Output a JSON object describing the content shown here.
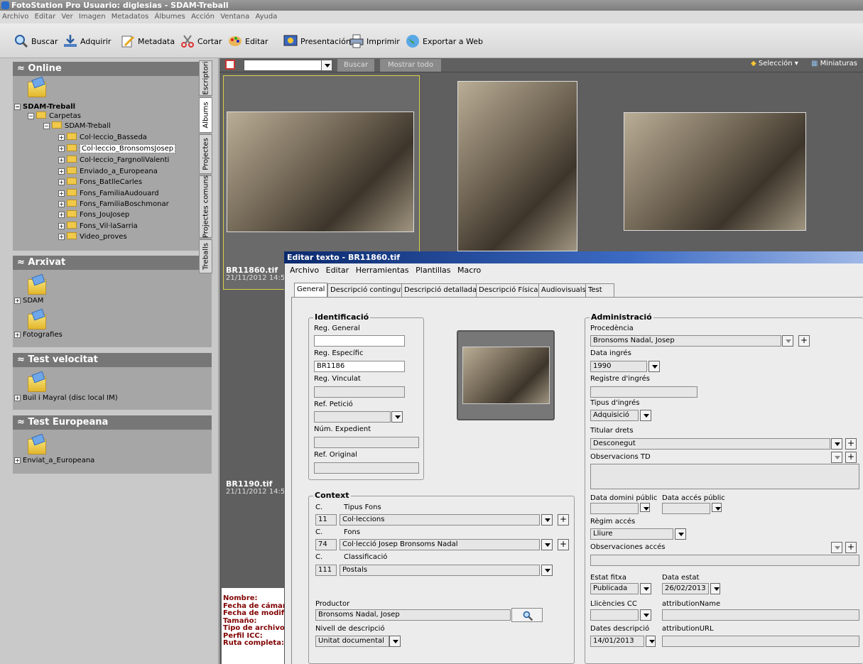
{
  "window": {
    "title": "FotoStation Pro  Usuario: diglesias - SDAM-Treball"
  },
  "menu": [
    "Archivo",
    "Editar",
    "Ver",
    "Imagen",
    "Metadatos",
    "Álbumes",
    "Acción",
    "Ventana",
    "Ayuda"
  ],
  "toolbar": {
    "buscar": "Buscar",
    "adquirir": "Adquirir",
    "metadata": "Metadata",
    "cortar": "Cortar",
    "editar": "Editar",
    "presentacion": "Presentación",
    "imprimir": "Imprimir",
    "exportar": "Exportar a Web"
  },
  "left": {
    "online": {
      "title": "Online",
      "root": "SDAM-Treball",
      "carpetas": "Carpetas",
      "sub": "SDAM-Treball",
      "folders": [
        "Col·leccio_Basseda",
        "Col·leccio_BronsomsJosep",
        "Col·leccio_FargnoliValenti",
        "Enviado_a_Europeana",
        "Fons_BatlleCarles",
        "Fons_FamiliaAudouard",
        "Fons_FamiliaBoschmonar",
        "Fons_JouJosep",
        "Fons_Vil·laSarria",
        "Video_proves"
      ]
    },
    "arxivat": {
      "title": "Arxivat",
      "items": [
        "SDAM",
        "Fotografies"
      ]
    },
    "test_velocitat": {
      "title": "Test velocitat",
      "items": [
        "Buil i Mayral (disc local IM)"
      ]
    },
    "test_europeana": {
      "title": "Test Europeana",
      "items": [
        "Enviat_a_Europeana"
      ]
    }
  },
  "vtabs": [
    "Escriptori",
    "Albums",
    "Projectes",
    "Projectes comuns",
    "Treballs"
  ],
  "browser": {
    "buscar": "Buscar",
    "mostrar": "Mostrar todo",
    "seleccion": "Selección",
    "miniaturas": "Miniaturas",
    "items": [
      {
        "name": "BR11860.tif",
        "date": "21/11/2012 14:5"
      },
      {
        "name": "BR1190.tif",
        "date": "21/11/2012 14:5"
      }
    ]
  },
  "info": [
    "Nombre:",
    "Fecha de cámar",
    "Fecha de modifi",
    "Tamaño:",
    "Tipo de archivo:",
    "Perfil ICC:",
    "Ruta completa:"
  ],
  "dialog": {
    "title": "Editar texto - BR11860.tif",
    "menu": [
      "Archivo",
      "Editar",
      "Herramientas",
      "Plantillas",
      "Macro"
    ],
    "tabs": [
      "General",
      "Descripció contingut",
      "Descripció detallada",
      "Descripció Física",
      "Audiovisuals",
      "Test"
    ],
    "ident": {
      "title": "Identificació",
      "reg_general": "Reg. General",
      "reg_especific": "Reg. Específic",
      "reg_especific_val": "BR1186",
      "reg_vinculat": "Reg. Vinculat",
      "ref_peticio": "Ref. Petició",
      "num_exp": "Núm. Expedient",
      "ref_original": "Ref. Original"
    },
    "context": {
      "title": "Context",
      "c": "C.",
      "tipus_fons": "Tipus Fons",
      "tipus_code": "11",
      "tipus_val": "Col·leccions",
      "fons": "Fons",
      "fons_code": "74",
      "fons_val": "Col·lecció Josep Bronsoms Nadal",
      "classif": "Classificació",
      "classif_code": "111",
      "classif_val": "Postals",
      "productor": "Productor",
      "productor_val": "Bronsoms Nadal, Josep",
      "nivell": "Nivell de descripció",
      "nivell_val": "Unitat documental"
    },
    "admin": {
      "title": "Administració",
      "procedencia": "Procedència",
      "procedencia_val": "Bronsoms Nadal, Josep",
      "data_ingres": "Data ingrés",
      "data_ingres_val": "1990",
      "registre": "Registre d'ingrés",
      "tipus_ingres": "Tipus d'ingrés",
      "tipus_ingres_val": "Adquisició",
      "titular": "Titular drets",
      "titular_val": "Desconegut",
      "obs_td": "Observacions TD",
      "data_domini": "Data domini públic",
      "data_acces": "Data accés públic",
      "regim": "Règim accés",
      "regim_val": "Lliure",
      "obs_acces": "Observaciones accés",
      "estat": "Estat fitxa",
      "estat_val": "Publicada",
      "data_estat": "Data estat",
      "data_estat_val": "26/02/2013",
      "llicencies": "Llicències CC",
      "attr_name": "attributionName",
      "dates_desc": "Dates descripció",
      "dates_desc_val": "14/01/2013",
      "attr_url": "attributionURL"
    }
  }
}
